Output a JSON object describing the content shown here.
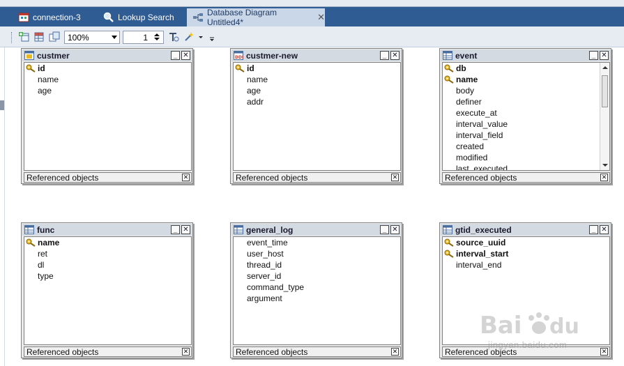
{
  "tabs": [
    {
      "label": "connection-3",
      "active": false
    },
    {
      "label": "Lookup Search",
      "active": false
    },
    {
      "label": "Database Diagram Untitled4*",
      "active": true
    }
  ],
  "toolbar": {
    "zoom_value": "100%",
    "page_value": "1"
  },
  "tables": [
    {
      "name": "custmer",
      "columns": [
        {
          "name": "id",
          "pk": true
        },
        {
          "name": "name",
          "pk": false
        },
        {
          "name": "age",
          "pk": false
        }
      ],
      "footer": "Referenced objects"
    },
    {
      "name": "custmer-new",
      "columns": [
        {
          "name": "id",
          "pk": true
        },
        {
          "name": "name",
          "pk": false
        },
        {
          "name": "age",
          "pk": false
        },
        {
          "name": "addr",
          "pk": false
        }
      ],
      "footer": "Referenced objects"
    },
    {
      "name": "event",
      "columns": [
        {
          "name": "db",
          "pk": true
        },
        {
          "name": "name",
          "pk": true
        },
        {
          "name": "body",
          "pk": false
        },
        {
          "name": "definer",
          "pk": false
        },
        {
          "name": "execute_at",
          "pk": false
        },
        {
          "name": "interval_value",
          "pk": false
        },
        {
          "name": "interval_field",
          "pk": false
        },
        {
          "name": "created",
          "pk": false
        },
        {
          "name": "modified",
          "pk": false
        },
        {
          "name": "last_executed",
          "pk": false
        }
      ],
      "footer": "Referenced objects"
    },
    {
      "name": "func",
      "columns": [
        {
          "name": "name",
          "pk": true
        },
        {
          "name": "ret",
          "pk": false
        },
        {
          "name": "dl",
          "pk": false
        },
        {
          "name": "type",
          "pk": false
        }
      ],
      "footer": "Referenced objects"
    },
    {
      "name": "general_log",
      "columns": [
        {
          "name": "event_time",
          "pk": false
        },
        {
          "name": "user_host",
          "pk": false
        },
        {
          "name": "thread_id",
          "pk": false
        },
        {
          "name": "server_id",
          "pk": false
        },
        {
          "name": "command_type",
          "pk": false
        },
        {
          "name": "argument",
          "pk": false
        }
      ],
      "footer": "Referenced objects"
    },
    {
      "name": "gtid_executed",
      "columns": [
        {
          "name": "source_uuid",
          "pk": true
        },
        {
          "name": "interval_start",
          "pk": true
        },
        {
          "name": "interval_end",
          "pk": false
        }
      ],
      "footer": "Referenced objects"
    }
  ],
  "watermark": {
    "logo_text": "Baidu经验",
    "url": "jingyan.baidu.com"
  },
  "colors": {
    "tab_bar": "#2f5c93",
    "active_tab": "#cad7e8",
    "title_bar": "#d4dae2",
    "key_icon": "#e8b923"
  }
}
